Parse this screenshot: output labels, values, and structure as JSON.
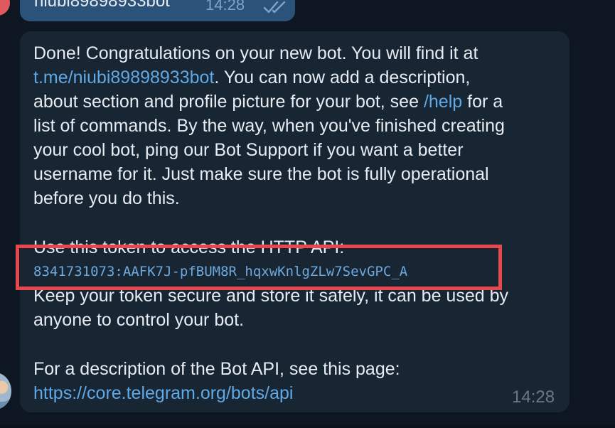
{
  "outgoing": {
    "text": "niubi89898933bot",
    "time": "14:28",
    "status_icon": "double-check-icon"
  },
  "incoming": {
    "lines": [
      {
        "before": "Done! Congratulations on your new bot. You will find it at",
        "link": "",
        "after": ""
      },
      {
        "before": "",
        "link": "t.me/niubi89898933bot",
        "after": ". You can now add a description,"
      },
      {
        "before": "about section and profile picture for your bot, see ",
        "link": "/help",
        "after": " for a"
      },
      {
        "before": "list of commands. By the way, when you've finished creating",
        "link": "",
        "after": ""
      },
      {
        "before": "your cool bot, ping our Bot Support if you want a better",
        "link": "",
        "after": ""
      },
      {
        "before": "username for it. Just make sure the bot is fully operational",
        "link": "",
        "after": ""
      },
      {
        "before": "before you do this.",
        "link": "",
        "after": ""
      },
      {
        "before": "Use this token to access the HTTP API:",
        "link": "",
        "after": ""
      },
      {
        "before": "Keep your token secure and store it safely, it can be used by",
        "link": "",
        "after": ""
      },
      {
        "before": "anyone to control your bot.",
        "link": "",
        "after": ""
      },
      {
        "before": "For a description of the Bot API, see this page:",
        "link": "",
        "after": ""
      },
      {
        "before": "",
        "link": "https://core.telegram.org/bots/api",
        "after": ""
      }
    ],
    "token": "8341731073:AAFK7J-pfBUM8R_hqxwKnlgZLw7SevGPC_A",
    "time": "14:28"
  },
  "colors": {
    "background": "#0e1621",
    "incoming_bubble": "#182533",
    "outgoing_bubble": "#2b5278",
    "link": "#5fa9e6",
    "highlight": "#e5484d"
  }
}
